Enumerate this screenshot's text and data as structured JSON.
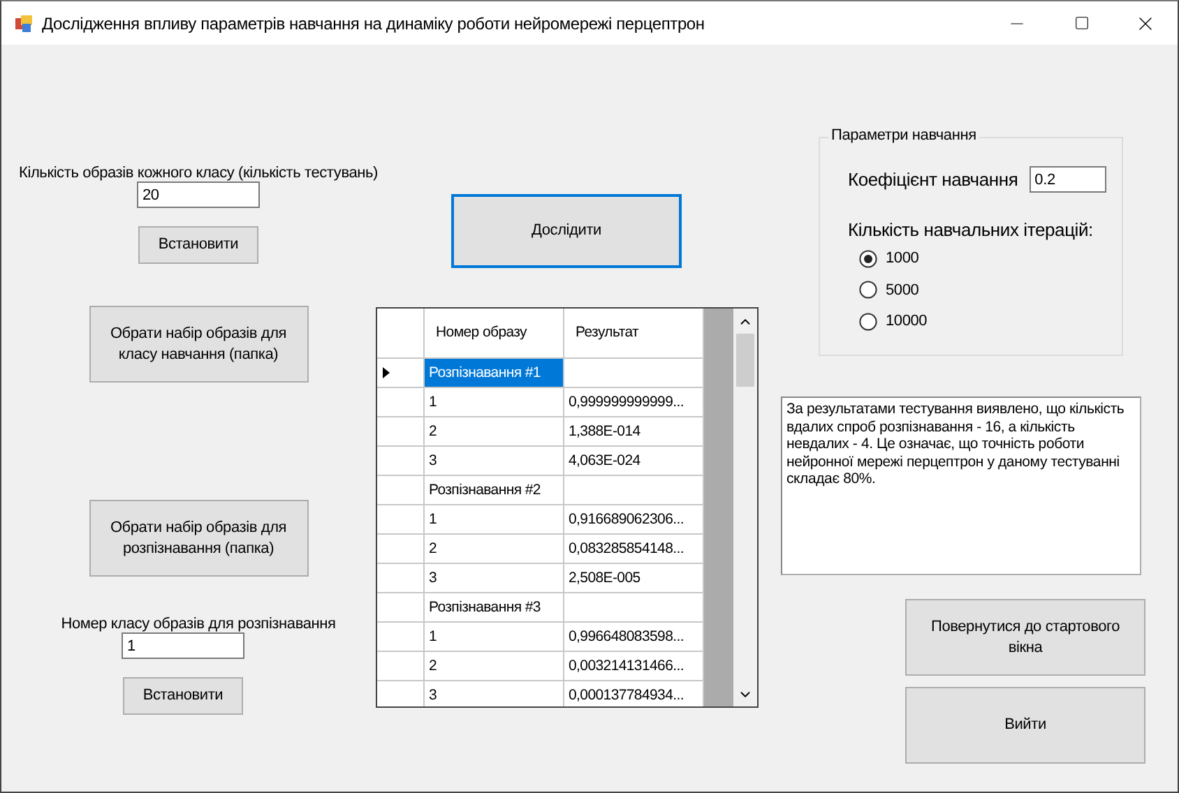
{
  "window": {
    "title": "Дослідження впливу параметрів навчання на динаміку роботи нейромережі перцептрон"
  },
  "left": {
    "count_label": "Кількість образів кожного класу (кількість тестувань)",
    "count_value": "20",
    "count_button": "Встановити",
    "train_button": "Обрати набір образів для класу навчання (папка)",
    "recognize_button": "Обрати набір образів для розпізнавання (папка)",
    "class_label": "Номер класу образів для розпізнавання",
    "class_value": "1",
    "class_button": "Встановити"
  },
  "research_button": "Дослідити",
  "table": {
    "columns": [
      "Номер образу",
      "Результат"
    ],
    "rows": [
      {
        "number": "Розпізнавання #1",
        "selected": true
      },
      {
        "number": "1",
        "result": "0,999999999999...",
        "selected": false
      },
      {
        "number": "2",
        "result": "1,388E-014",
        "selected": false
      },
      {
        "number": "3",
        "result": "4,063E-024",
        "selected": false
      },
      {
        "number": "Розпізнавання #2",
        "selected": false
      },
      {
        "number": "1",
        "result": "0,916689062306...",
        "selected": false
      },
      {
        "number": "2",
        "result": "0,083285854148...",
        "selected": false
      },
      {
        "number": "3",
        "result": "2,508E-005",
        "selected": false
      },
      {
        "number": "Розпізнавання #3",
        "selected": false
      },
      {
        "number": "1",
        "result": "0,996648083598...",
        "selected": false
      },
      {
        "number": "2",
        "result": "0,003214131466...",
        "selected": false
      },
      {
        "number": "3",
        "result": "0,000137784934...",
        "selected": false
      }
    ]
  },
  "params": {
    "title": "Параметри навчання",
    "rate_label": "Коефіцієнт навчання",
    "rate_value": "0.2",
    "iterations_label": "Кількість навчальних ітерацій:",
    "iterations": [
      {
        "label": "1000",
        "selected": true
      },
      {
        "label": "5000",
        "selected": false
      },
      {
        "label": "10000",
        "selected": false
      }
    ]
  },
  "result_text": "За результатами тестування виявлено, що кількість вдалих спроб розпізнавання - 16, а кількість невдалих - 4. Це означає, що точність роботи нейронної мережі перцептрон у даному тестуванні складає 80%.",
  "buttons": [
    "Повернутися до стартового вікна",
    "Вийти"
  ]
}
